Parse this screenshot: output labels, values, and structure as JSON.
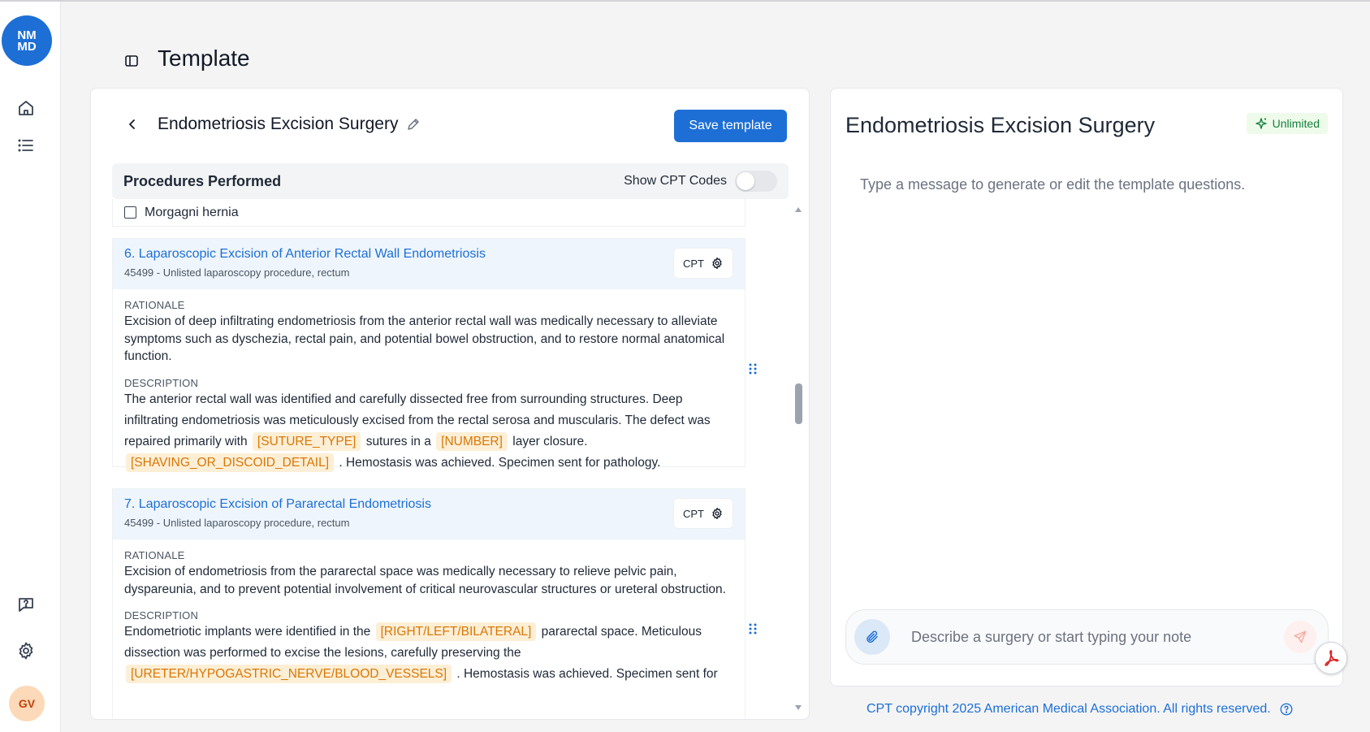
{
  "app": {
    "logo_text": "NM MD",
    "avatar_initials": "GV",
    "accent_color": "#1d6fd6",
    "icons": [
      "home-icon",
      "list-icon",
      "help-icon",
      "gear-icon"
    ]
  },
  "header": {
    "title": "Template"
  },
  "editor": {
    "template_name": "Endometriosis Excision Surgery",
    "save_label": "Save template",
    "procedures_title": "Procedures Performed",
    "show_cpt_label": "Show CPT Codes",
    "show_cpt_enabled": false,
    "prev_item_label": "Morgagni hernia",
    "prev_item_checked": false,
    "rationale_label": "RATIONALE",
    "description_label": "DESCRIPTION",
    "cpt_button_label": "CPT",
    "procedures": [
      {
        "title": "6. Laparoscopic Excision of Anterior Rectal Wall Endometriosis",
        "code_line": "45499 - Unlisted laparoscopy procedure, rectum",
        "rationale": "Excision of deep infiltrating endometriosis from the anterior rectal wall was medically necessary to alleviate symptoms such as dyschezia, rectal pain, and potential bowel obstruction, and to restore normal anatomical function.",
        "desc_1": "The anterior rectal wall was identified and carefully dissected free from surrounding structures. Deep infiltrating endometriosis was meticulously excised from the rectal serosa and muscularis. The defect was repaired primarily with",
        "ph_1": "[SUTURE_TYPE]",
        "desc_2": "sutures in a",
        "ph_2": "[NUMBER]",
        "desc_3": "layer closure.",
        "ph_3": "[SHAVING_OR_DISCOID_DETAIL]",
        "desc_4": ". Hemostasis was achieved. Specimen sent for pathology."
      },
      {
        "title": "7. Laparoscopic Excision of Pararectal Endometriosis",
        "code_line": "45499 - Unlisted laparoscopy procedure, rectum",
        "rationale": "Excision of endometriosis from the pararectal space was medically necessary to relieve pelvic pain, dyspareunia, and to prevent potential involvement of critical neurovascular structures or ureteral obstruction.",
        "desc_1": "Endometriotic implants were identified in the",
        "ph_1": "[RIGHT/LEFT/BILATERAL]",
        "desc_2": "pararectal space. Meticulous dissection was performed to excise the lesions, carefully preserving the",
        "ph_2": "[URETER/HYPOGASTRIC_NERVE/BLOOD_VESSELS]",
        "desc_3": ". Hemostasis was achieved. Specimen sent for"
      }
    ]
  },
  "assistant": {
    "title": "Endometriosis Excision Surgery",
    "badge": "Unlimited",
    "hint": "Type a message to generate or edit the template questions.",
    "input_placeholder": "Describe a surgery or start typing your note"
  },
  "footer": {
    "copyright": "CPT copyright 2025 American Medical Association. All rights reserved."
  }
}
